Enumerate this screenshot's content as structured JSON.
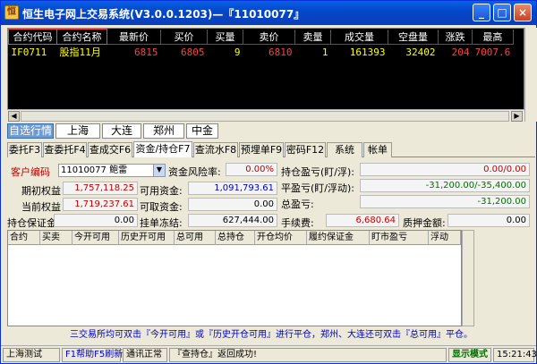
{
  "window": {
    "title": "恒生电子网上交易系统(V3.0.0.1203)—『11010077』",
    "minimize": "_",
    "maximize": "□",
    "close": "×"
  },
  "quote": {
    "columns": [
      "合约代码",
      "合约名称",
      "最新价",
      "买价",
      "买量",
      "卖价",
      "卖量",
      "成交量",
      "空盘量",
      "涨跌",
      "最高"
    ],
    "rows": [
      [
        "IF0711",
        "股指11月",
        "6815",
        "6805",
        "9",
        "6810",
        "1",
        "161393",
        "32402",
        "204",
        "7007.6"
      ]
    ]
  },
  "exchanges": [
    "自选行情",
    "上海",
    "大连",
    "郑州",
    "中金"
  ],
  "function_tabs": [
    "委托F3",
    "查委托F4",
    "查成交F6",
    "资金/持仓F7",
    "查流水F8",
    "预埋单F9",
    "密码F12",
    "系统",
    "帐单"
  ],
  "fund": {
    "account_label": "客户编码",
    "account_value": "11010077 鲍雷",
    "risk_label": "资金风险率:",
    "risk_value": "0.00%",
    "hold_pl_label": "持仓盈亏(盯/浮):",
    "hold_pl_value": "0.00/0.00",
    "init_equity_label": "期初权益",
    "init_equity_value": "1,757,118.25",
    "available_label": "可用资金:",
    "available_value": "1,091,793.61",
    "close_pl_label": "平盈亏(盯/浮动):",
    "close_pl_value": "-31,200.00/-35,400.00",
    "cur_equity_label": "当前权益",
    "cur_equity_value": "1,719,237.61",
    "withdraw_label": "可取资金:",
    "withdraw_value": "0.00",
    "total_pl_label": "总盈亏:",
    "total_pl_value": "-31,200.00",
    "margin_label": "持仓保证金",
    "margin_value": "0.00",
    "frozen_label": "挂单冻结:",
    "frozen_value": "627,444.00",
    "fee_label": "手续费:",
    "fee_value": "6,680.64",
    "pledge_label": "质押金额:",
    "pledge_value": "0.00"
  },
  "holdings": {
    "columns": [
      "合约",
      "买卖",
      "今开可用",
      "历史开可用",
      "总可用",
      "总持仓",
      "开仓均价",
      "履约保证金",
      "盯市盈亏",
      "浮动"
    ]
  },
  "notice": "三交易所均可双击『今开可用』或『历史开仓可用』进行平仓，郑州、大连还可双击『总可用』平仓。",
  "status": {
    "site": "上海测试",
    "help": "F1帮助F5刷新",
    "comm": "通讯正常",
    "message": "『查持仓』返回成功!",
    "mode": "显示模式",
    "time": "15:21:43"
  }
}
